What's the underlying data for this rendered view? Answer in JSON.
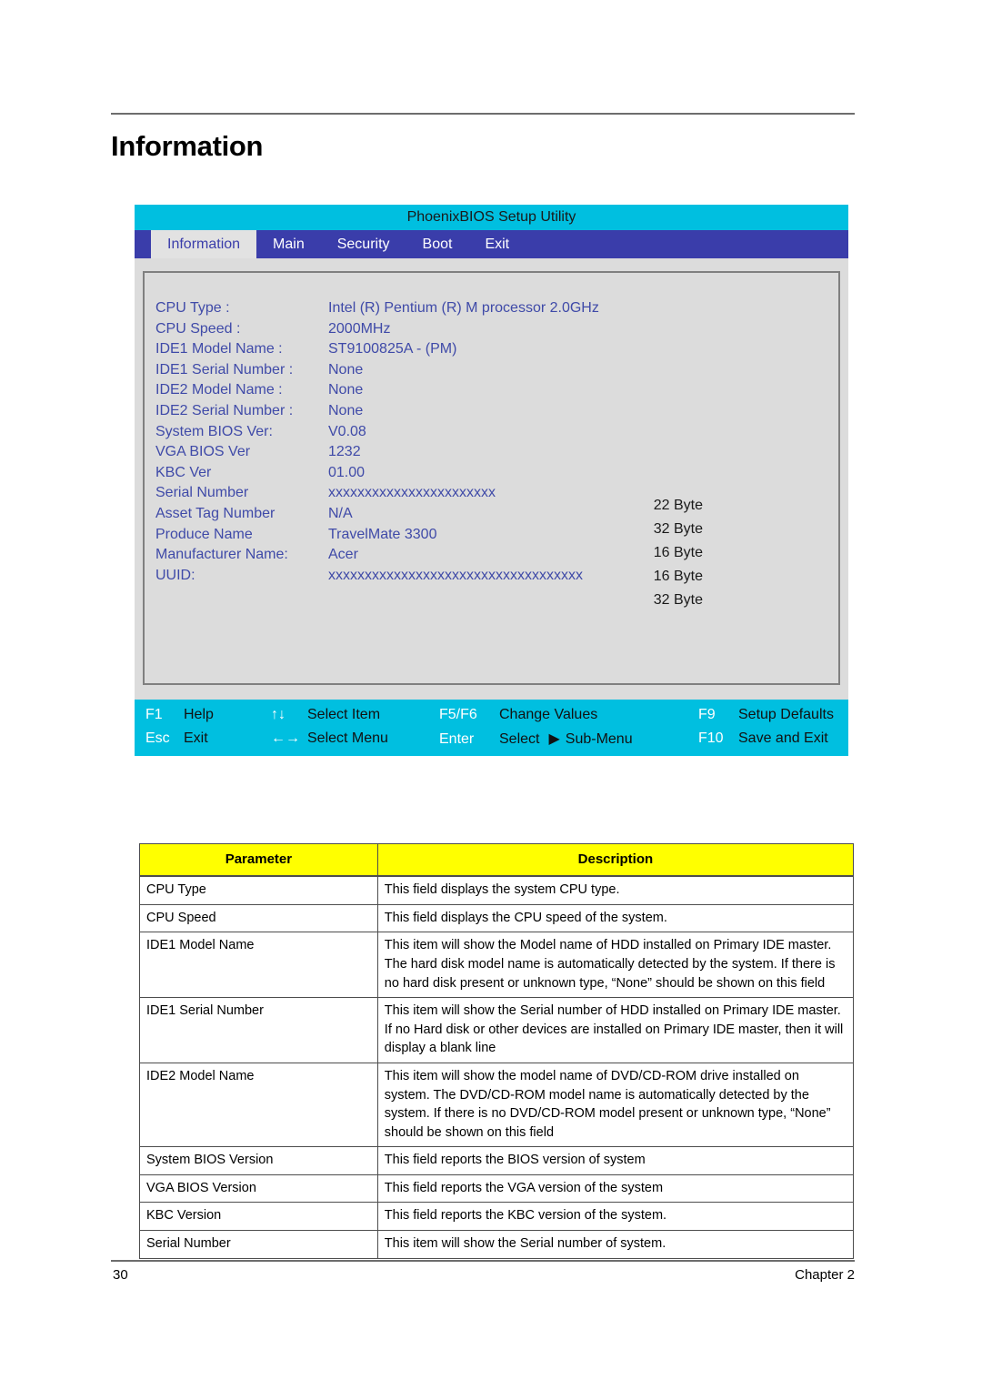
{
  "page": {
    "title": "Information",
    "number": "30",
    "chapter": "Chapter 2"
  },
  "bios": {
    "titlebar": "PhoenixBIOS Setup Utility",
    "tabs": [
      {
        "label": "Information",
        "active": true
      },
      {
        "label": "Main",
        "active": false
      },
      {
        "label": "Security",
        "active": false
      },
      {
        "label": "Boot",
        "active": false
      },
      {
        "label": "Exit",
        "active": false
      }
    ],
    "fields": [
      {
        "label": "CPU Type :",
        "value": "Intel (R) Pentium (R) M processor 2.0GHz"
      },
      {
        "label": "CPU Speed :",
        "value": "2000MHz"
      },
      {
        "label": "IDE1 Model Name :",
        "value": "ST9100825A - (PM)"
      },
      {
        "label": "IDE1 Serial Number :",
        "value": "None"
      },
      {
        "label": "IDE2 Model Name :",
        "value": "None"
      },
      {
        "label": "IDE2 Serial Number :",
        "value": "None"
      },
      {
        "label": "System BIOS Ver:",
        "value": "V0.08"
      },
      {
        "label": "VGA BIOS Ver",
        "value": "1232"
      },
      {
        "label": "KBC Ver",
        "value": "01.00"
      },
      {
        "label": "Serial Number",
        "value": "xxxxxxxxxxxxxxxxxxxxxxx"
      },
      {
        "label": "Asset Tag Number",
        "value": "N/A"
      },
      {
        "label": "Produce Name",
        "value": "TravelMate 3300"
      },
      {
        "label": "Manufacturer Name:",
        "value": "Acer"
      },
      {
        "label": "UUID:",
        "value": "xxxxxxxxxxxxxxxxxxxxxxxxxxxxxxxxxxx"
      }
    ],
    "byte_sizes": [
      "22 Byte",
      "32 Byte",
      "16 Byte",
      "16 Byte",
      "32 Byte"
    ],
    "help_bar": {
      "row1": [
        {
          "key": "F1",
          "desc": "Help"
        },
        {
          "key": "↑↓",
          "desc": "Select Item"
        },
        {
          "key": "F5/F6",
          "desc": "Change Values"
        },
        {
          "key": "F9",
          "desc": "Setup Defaults"
        }
      ],
      "row2": [
        {
          "key": "Esc",
          "desc": "Exit"
        },
        {
          "key": "←→",
          "desc": "Select Menu"
        },
        {
          "key": "Enter",
          "desc": "Select"
        },
        {
          "key": "F10",
          "desc": "Save and Exit"
        }
      ],
      "submenu_label": "Sub‑Menu",
      "submenu_arrow": "▶"
    }
  },
  "parameter_table": {
    "headers": [
      "Parameter",
      "Description"
    ],
    "rows": [
      {
        "parameter": "CPU Type",
        "description": "This field displays the system CPU type."
      },
      {
        "parameter": "CPU Speed",
        "description": "This field displays the CPU speed of the system."
      },
      {
        "parameter": "IDE1 Model Name",
        "description": "This item will show the Model name of HDD installed on Primary IDE master. The hard disk model name is automatically detected by the system. If there is no hard disk present or unknown type, “None” should be shown on this field"
      },
      {
        "parameter": "IDE1 Serial Number",
        "description": "This item will show the Serial number of HDD installed on Primary IDE master. If no Hard disk or other devices are installed on Primary IDE master, then it will display a blank line"
      },
      {
        "parameter": "IDE2 Model Name",
        "description": "This item will show the model name of DVD/CD-ROM drive installed on system. The DVD/CD-ROM model name is automatically detected by the system. If there is no DVD/CD-ROM model present or unknown type, “None” should be shown on this field"
      },
      {
        "parameter": "System BIOS Version",
        "description": "This field reports the BIOS version of system"
      },
      {
        "parameter": "VGA BIOS Version",
        "description": "This field reports the VGA version of the system"
      },
      {
        "parameter": "KBC Version",
        "description": "This field reports the KBC version of the system."
      },
      {
        "parameter": "Serial Number",
        "description": "This item will show the Serial number of system."
      }
    ]
  },
  "colors": {
    "titlebar_cyan": "#00bfe0",
    "tabstrip_blue": "#3a3daa",
    "bios_grey": "#dcdcdc",
    "field_text_blue": "#3f4aa8",
    "table_header_yellow": "#ffff00"
  }
}
